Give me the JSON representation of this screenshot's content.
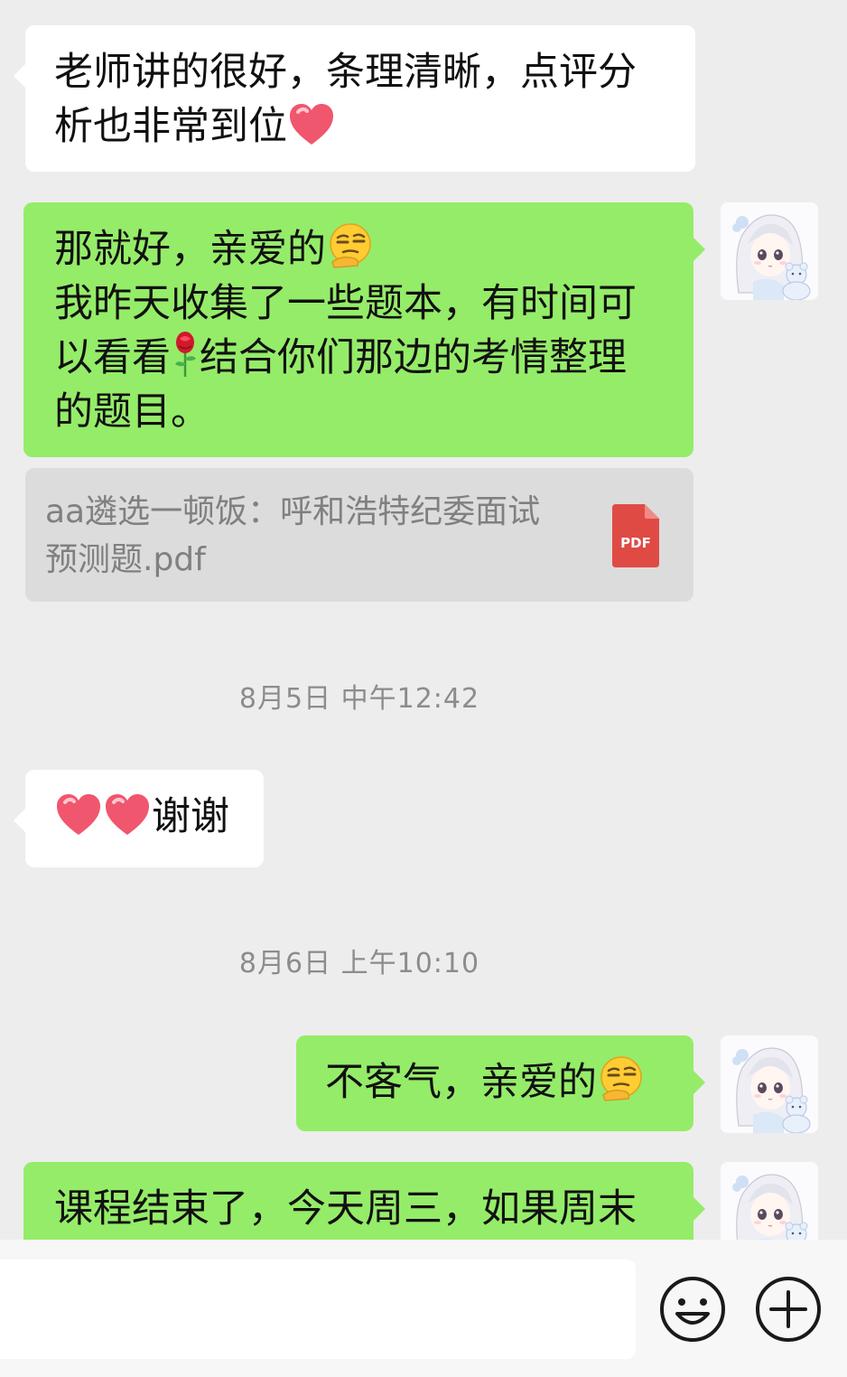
{
  "messages": {
    "m1": {
      "sender": "contact",
      "line1": "老师讲的很好，条理清晰，点评分",
      "line2": "析也非常到位",
      "emoji": "heart"
    },
    "m2": {
      "sender": "me",
      "line1": "那就好，亲爱的",
      "line1_emoji": "thinking-face",
      "line2": "我昨天收集了一些题本，有时间可",
      "line3_a": "以看看",
      "line3_emoji": "rose",
      "line3_b": "结合你们那边的考情整理",
      "line4": "的题目。"
    },
    "file": {
      "line1": "aa遴选一顿饭：呼和浩特纪委面试",
      "line2": "预测题.pdf",
      "icon_label": "PDF"
    },
    "m3": {
      "sender": "contact",
      "emojis": [
        "heart",
        "heart"
      ],
      "text": "谢谢"
    },
    "m4": {
      "sender": "me",
      "text": "不客气，亲爱的",
      "emoji": "thinking-face"
    },
    "m5": {
      "sender": "me",
      "text": "课程结束了，今天周三，如果周末"
    }
  },
  "timestamps": {
    "t1": "8月5日 中午12:42",
    "t2": "8月6日 上午10:10"
  },
  "input_bar": {
    "placeholder": "",
    "emoji_button_icon": "smiley-face-icon",
    "more_button_icon": "plus-circle-icon"
  },
  "colors": {
    "chat_background": "#ededed",
    "incoming_bubble": "#ffffff",
    "outgoing_bubble": "#95ec69",
    "file_card": "#dcdcdc",
    "pdf_icon": "#e04a45",
    "timestamp_text": "#8c8c8c"
  }
}
